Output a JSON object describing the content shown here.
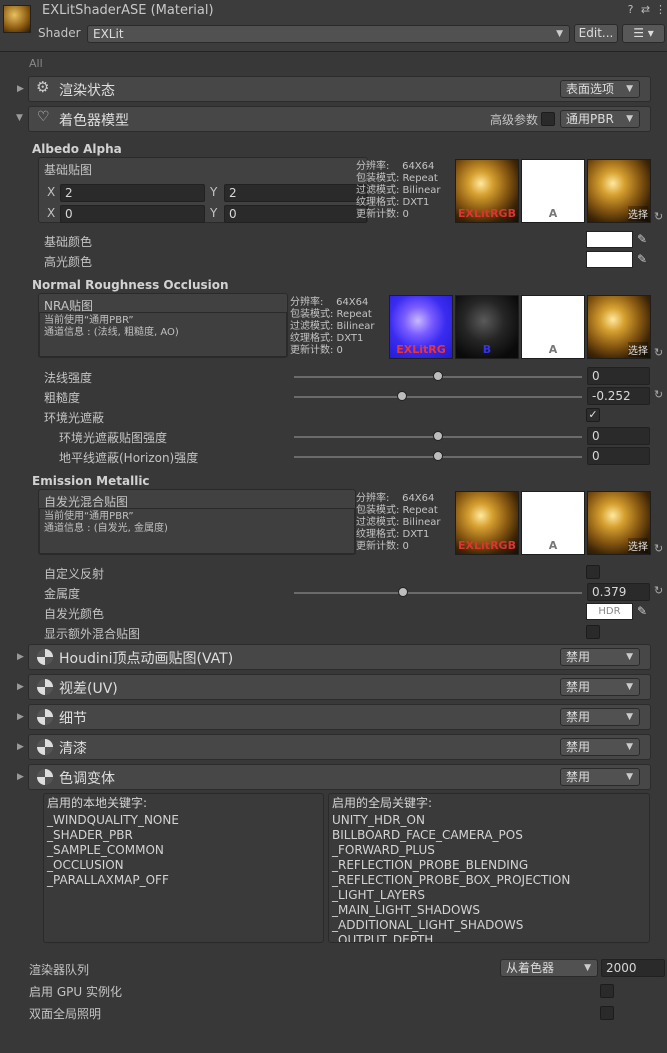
{
  "header": {
    "title": "EXLitShaderASE (Material)",
    "shader_label": "Shader",
    "shader_value": "EXLit",
    "edit_label": "Edit...",
    "list_icon": "list-icon",
    "help_icon": "help-icon",
    "preset_icon": "preset-icon",
    "more_icon": "more-icon"
  },
  "all_label": "All",
  "sections": {
    "render_state": {
      "title": "渲染状态",
      "dropdown": "表面选项"
    },
    "shading_model": {
      "title": "着色器模型",
      "adv_label": "高级参数",
      "dropdown": "通用PBR"
    }
  },
  "albedo": {
    "group_title": "Albedo Alpha",
    "map_label": "基础贴图",
    "tiling": {
      "x_label": "X",
      "y_label": "Y",
      "x": "2",
      "y": "2"
    },
    "offset": {
      "x_label": "X",
      "y_label": "Y",
      "x": "0",
      "y": "0"
    },
    "meta": "分辨率:    64X64\n包装模式: Repeat\n过滤模式: Bilinear\n纹理格式: DXT1\n更新计数: 0",
    "thumb_labels": [
      "EXLitRGB",
      "A"
    ],
    "select_label": "选择",
    "base_color_label": "基础颜色",
    "spec_color_label": "高光颜色"
  },
  "nra": {
    "group_title": "Normal Roughness Occlusion",
    "map_label": "NRA贴图",
    "info_line1": "当前使用“通用PBR”",
    "info_line2": "通道信息 : (法线, 粗糙度, AO)",
    "meta": "分辨率:    64X64\n包装模式: Repeat\n过滤模式: Bilinear\n纹理格式: DXT1\n更新计数: 0",
    "thumb_labels": [
      "EXLitRG",
      "B",
      "A"
    ],
    "select_label": "选择",
    "normal_label": "法线强度",
    "normal_value": "0",
    "normal_fraction": 0.5,
    "rough_label": "粗糙度",
    "rough_value": "-0.252",
    "rough_fraction": 0.374,
    "ao_label": "环境光遮蔽",
    "ao_checked": true,
    "ao_strength_label": "环境光遮蔽贴图强度",
    "ao_strength_value": "0",
    "ao_strength_fraction": 0.5,
    "horizon_label": "地平线遮蔽(Horizon)强度",
    "horizon_value": "0",
    "horizon_fraction": 0.5
  },
  "emission": {
    "group_title": "Emission Metallic",
    "map_label": "自发光混合贴图",
    "info_line1": "当前使用“通用PBR”",
    "info_line2": "通道信息 : (自发光, 金属度)",
    "meta": "分辨率:    64X64\n包装模式: Repeat\n过滤模式: Bilinear\n纹理格式: DXT1\n更新计数: 0",
    "thumb_labels": [
      "EXLitRGB",
      "A"
    ],
    "select_label": "选择",
    "custom_refl_label": "自定义反射",
    "metal_label": "金属度",
    "metal_value": "0.379",
    "metal_fraction": 0.379,
    "emis_color_label": "自发光颜色",
    "hdr_label": "HDR",
    "extra_blend_label": "显示额外混合贴图"
  },
  "collapsed_sections": [
    {
      "title": "Houdini顶点动画贴图(VAT)",
      "dropdown": "禁用"
    },
    {
      "title": "视差(UV)",
      "dropdown": "禁用"
    },
    {
      "title": "细节",
      "dropdown": "禁用"
    },
    {
      "title": "清漆",
      "dropdown": "禁用"
    },
    {
      "title": "色调变体",
      "dropdown": "禁用"
    }
  ],
  "keywords": {
    "local_title": "启用的本地关键字:",
    "local": [
      "_WINDQUALITY_NONE",
      "_SHADER_PBR",
      "_SAMPLE_COMMON",
      "_OCCLUSION",
      "_PARALLAXMAP_OFF"
    ],
    "global_title": "启用的全局关键字:",
    "global": [
      "UNITY_HDR_ON",
      "BILLBOARD_FACE_CAMERA_POS",
      "_FORWARD_PLUS",
      "_REFLECTION_PROBE_BLENDING",
      "_REFLECTION_PROBE_BOX_PROJECTION",
      "_LIGHT_LAYERS",
      "_MAIN_LIGHT_SHADOWS",
      "_ADDITIONAL_LIGHT_SHADOWS",
      "_OUTPUT_DEPTH"
    ]
  },
  "footer": {
    "queue_label": "渲染器队列",
    "queue_dropdown": "从着色器",
    "queue_value": "2000",
    "gpu_label": "启用 GPU 实例化",
    "gi_label": "双面全局照明"
  },
  "colors": {
    "background": "#383838",
    "section": "#474747",
    "field": "#2a2a2a"
  }
}
